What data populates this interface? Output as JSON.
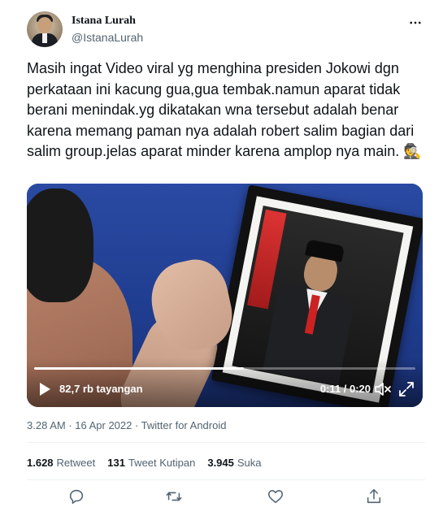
{
  "author": {
    "name": "Istana Lurah",
    "handle": "@IstanaLurah"
  },
  "tweet": {
    "text": "Masih ingat Video viral yg menghina presiden Jokowi dgn perkataan ini kacung gua,gua tembak.namun aparat tidak berani menindak.yg dikatakan wna tersebut adalah benar karena memang paman nya adalah robert salim bagian dari salim group.jelas aparat minder karena amplop nya main. 🕵️"
  },
  "video": {
    "views": "82,7 rb tayangan",
    "time": "0:11 / 0:20",
    "progress": 0.55
  },
  "meta": {
    "timestamp": "3.28 AM · 16 Apr 2022 · Twitter for Android"
  },
  "stats": {
    "retweets_count": "1.628",
    "retweets_label": "Retweet",
    "quotes_count": "131",
    "quotes_label": "Tweet Kutipan",
    "likes_count": "3.945",
    "likes_label": "Suka"
  },
  "colors": {
    "text": "#0f1419",
    "secondary": "#536471",
    "divider": "#eff3f4"
  },
  "icons": [
    "more-icon",
    "play-icon",
    "mute-icon",
    "fullscreen-icon",
    "reply-icon",
    "retweet-icon",
    "like-icon",
    "share-icon"
  ]
}
